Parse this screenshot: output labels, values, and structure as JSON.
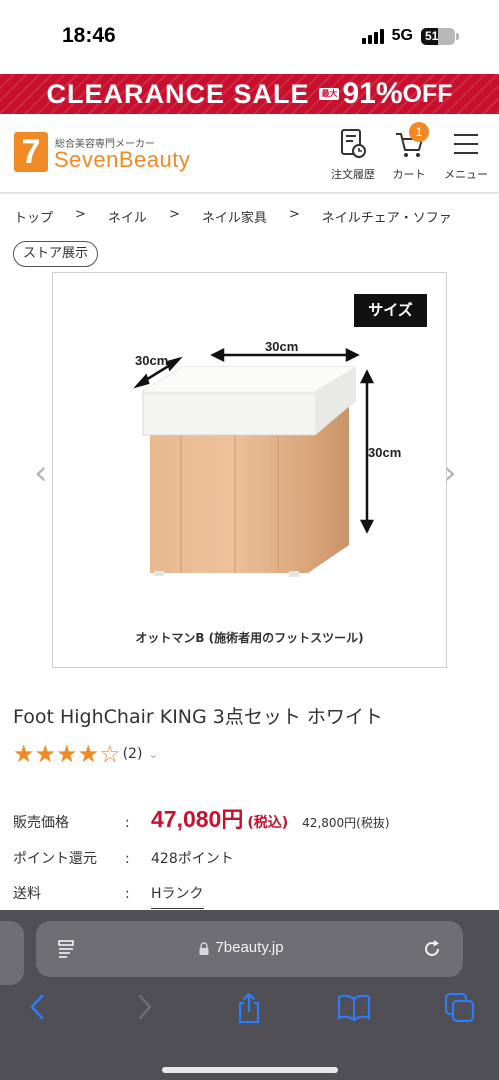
{
  "status": {
    "time": "18:46",
    "network": "5G",
    "battery": "51",
    "battery_level": 0.51
  },
  "banner": {
    "text": "CLEARANCE SALE",
    "badge": "最大",
    "percent": "91%",
    "off": "OFF"
  },
  "header": {
    "logo_mark": "7",
    "logo_sub": "総合美容専門メーカー",
    "logo_name": "SevenBeauty",
    "orders_label": "注文履歴",
    "cart_label": "カート",
    "cart_count": "1",
    "menu_label": "メニュー"
  },
  "breadcrumb": {
    "items": [
      "トップ",
      "ネイル",
      "ネイル家具",
      "ネイルチェア・ソファ"
    ],
    "separator": ">"
  },
  "store_tag": "ストア展示",
  "product_image": {
    "size_tag": "サイズ",
    "dim_width": "30cm",
    "dim_depth": "30cm",
    "dim_height": "30cm",
    "caption": "オットマンB (施術者用のフットスツール)",
    "prev_arrow": "‹",
    "next_arrow": "›"
  },
  "product": {
    "title": "Foot HighChair KING 3点セット ホワイト",
    "rating": 4,
    "rating_max": 5,
    "review_count": "(2)",
    "price_label": "販売価格",
    "colon": ":",
    "price": "47,080",
    "price_unit": "円",
    "tax_in": "(税込)",
    "tax_ex": "42,800円(税抜)",
    "points_label": "ポイント還元",
    "points_value": "428ポイント",
    "shipping_label": "送料",
    "shipping_value": "Hランク"
  },
  "browser": {
    "domain": "7beauty.jp"
  }
}
